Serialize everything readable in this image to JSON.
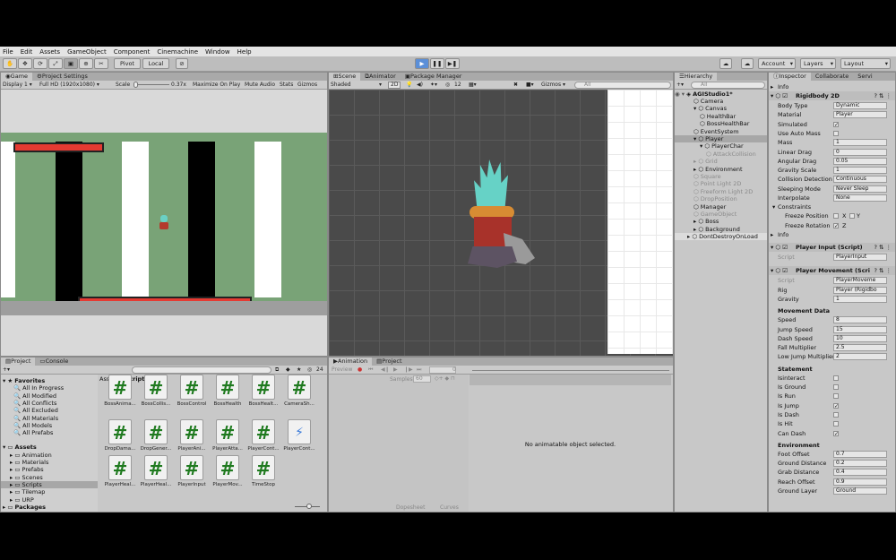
{
  "menu": [
    "File",
    "Edit",
    "Assets",
    "GameObject",
    "Component",
    "Cinemachine",
    "Window",
    "Help"
  ],
  "toolbar": {
    "pivot": "Pivot",
    "local": "Local",
    "account": "Account",
    "layers": "Layers",
    "layout": "Layout"
  },
  "game_panel": {
    "tabs": [
      "Game",
      "Project Settings"
    ],
    "display": "Display 1",
    "resolution": "Full HD (1920x1080)",
    "scale_label": "Scale",
    "scale_value": "0.37x",
    "maximize": "Maximize On Play",
    "mute": "Mute Audio",
    "stats": "Stats",
    "gizmos": "Gizmos"
  },
  "scene_panel": {
    "tabs": [
      "Scene",
      "Animator",
      "Package Manager"
    ],
    "shading": "Shaded",
    "mode_2d": "2D",
    "layer_count": "12",
    "gizmos": "Gizmos",
    "search_placeholder": "All"
  },
  "hierarchy": {
    "tab": "Hierarchy",
    "search_placeholder": "All",
    "scene": "AGIStudio1*",
    "items": [
      {
        "label": "Camera",
        "depth": 1
      },
      {
        "label": "Canvas",
        "depth": 1
      },
      {
        "label": "HealthBar",
        "depth": 2
      },
      {
        "label": "BossHealthBar",
        "depth": 2
      },
      {
        "label": "EventSystem",
        "depth": 1
      },
      {
        "label": "Player",
        "depth": 1
      },
      {
        "label": "PlayerChar",
        "depth": 2
      },
      {
        "label": "AttackCollision",
        "depth": 3,
        "dim": true
      },
      {
        "label": "Grid",
        "depth": 1,
        "dim": true
      },
      {
        "label": "Environment",
        "depth": 1
      },
      {
        "label": "Square",
        "depth": 1,
        "dim": true
      },
      {
        "label": "Point Light 2D",
        "depth": 1,
        "dim": true
      },
      {
        "label": "Freeform Light 2D",
        "depth": 1,
        "dim": true
      },
      {
        "label": "DropPosition",
        "depth": 1,
        "dim": true
      },
      {
        "label": "Manager",
        "depth": 1
      },
      {
        "label": "GameObject",
        "depth": 1,
        "dim": true
      },
      {
        "label": "Boss",
        "depth": 1
      },
      {
        "label": "Background",
        "depth": 1
      },
      {
        "label": "DontDestroyOnLoad",
        "depth": 0
      }
    ]
  },
  "inspector": {
    "tabs": [
      "Inspector",
      "Collaborate",
      "Servi"
    ],
    "info": "Info",
    "rigidbody_title": "Rigidbody 2D",
    "rigidbody_rows": [
      {
        "label": "Body Type",
        "value": "Dynamic"
      },
      {
        "label": "Material",
        "value": "Player"
      },
      {
        "label": "Simulated",
        "check": "✓"
      },
      {
        "label": "Use Auto Mass",
        "check": ""
      },
      {
        "label": "Mass",
        "value": "1"
      },
      {
        "label": "Linear Drag",
        "value": "0"
      },
      {
        "label": "Angular Drag",
        "value": "0.05"
      },
      {
        "label": "Gravity Scale",
        "value": "1"
      },
      {
        "label": "Collision Detection",
        "value": "Continuous"
      },
      {
        "label": "Sleeping Mode",
        "value": "Never Sleep"
      },
      {
        "label": "Interpolate",
        "value": "None"
      }
    ],
    "constraints": "Constraints",
    "freeze_pos": "Freeze Position",
    "freeze_rot": "Freeze Rotation",
    "x": "X",
    "y": "Y",
    "z": "Z",
    "info2": "Info",
    "player_input_title": "Player Input (Script)",
    "script_label": "Script",
    "player_input_script": "PlayerInput",
    "player_movement_title": "Player Movement (Scri",
    "movement_rows": [
      {
        "label": "Script",
        "value": "PlayerMoveme"
      },
      {
        "label": "Rig",
        "value": "Player (Rigidbo"
      },
      {
        "label": "Gravity",
        "value": "1"
      }
    ],
    "movement_data": "Movement Data",
    "movement_data_rows": [
      {
        "label": "Speed",
        "value": "8"
      },
      {
        "label": "Jump Speed",
        "value": "15"
      },
      {
        "label": "Dash Speed",
        "value": "10"
      },
      {
        "label": "Fall Multiplier",
        "value": "2.5"
      },
      {
        "label": "Low Jump Multiplier",
        "value": "2"
      }
    ],
    "statement": "Statement",
    "statement_rows": [
      {
        "label": "Isinteract",
        "check": ""
      },
      {
        "label": "Is Ground",
        "check": ""
      },
      {
        "label": "Is Run",
        "check": ""
      },
      {
        "label": "Is Jump",
        "check": "✓"
      },
      {
        "label": "Is Dash",
        "check": ""
      },
      {
        "label": "Is Hit",
        "check": ""
      },
      {
        "label": "Can Dash",
        "check": "✓"
      }
    ],
    "environment": "Environment",
    "environment_rows": [
      {
        "label": "Foot Offset",
        "value": "0.7"
      },
      {
        "label": "Ground Distance",
        "value": "0.2"
      },
      {
        "label": "Grab Distance",
        "value": "0.4"
      },
      {
        "label": "Reach Offset",
        "value": "0.9"
      },
      {
        "label": "Ground Layer",
        "value": "Ground"
      }
    ]
  },
  "project": {
    "tabs": [
      "Project",
      "Console"
    ],
    "count": "24",
    "favorites_label": "Favorites",
    "favorites": [
      "All In Progress",
      "All Modified",
      "All Conflicts",
      "All Excluded",
      "All Materials",
      "All Models",
      "All Prefabs"
    ],
    "assets_label": "Assets",
    "assets": [
      "Animation",
      "Materials",
      "Prefabs",
      "Scenes",
      "Scripts",
      "Tilemap",
      "URP"
    ],
    "packages_label": "Packages",
    "breadcrumb_root": "Assets",
    "breadcrumb_sep": "▸",
    "breadcrumb_leaf": "Scripts",
    "files": [
      "BossAnima...",
      "BossCollis...",
      "BossControl",
      "BossHealth",
      "BossHealt...",
      "CameraSh...",
      "DropDama...",
      "DropGener...",
      "PlayerAni...",
      "PlayerAtta...",
      "PlayerCont...",
      "PlayerCont...",
      "PlayerHeal...",
      "PlayerHeal...",
      "PlayerInput",
      "PlayerMov...",
      "TimeStop"
    ]
  },
  "animation": {
    "tabs": [
      "Animation",
      "Project"
    ],
    "preview": "Preview",
    "samples_label": "Samples",
    "samples_value": "60",
    "frame": "0",
    "empty": "No animatable object selected.",
    "dopesheet": "Dopesheet",
    "curves": "Curves"
  },
  "colors": {
    "game_bg": "#79a377",
    "red_bar": "#e53a32",
    "scene_bg": "#4a4a4a",
    "selection": "#3d7bd9"
  }
}
